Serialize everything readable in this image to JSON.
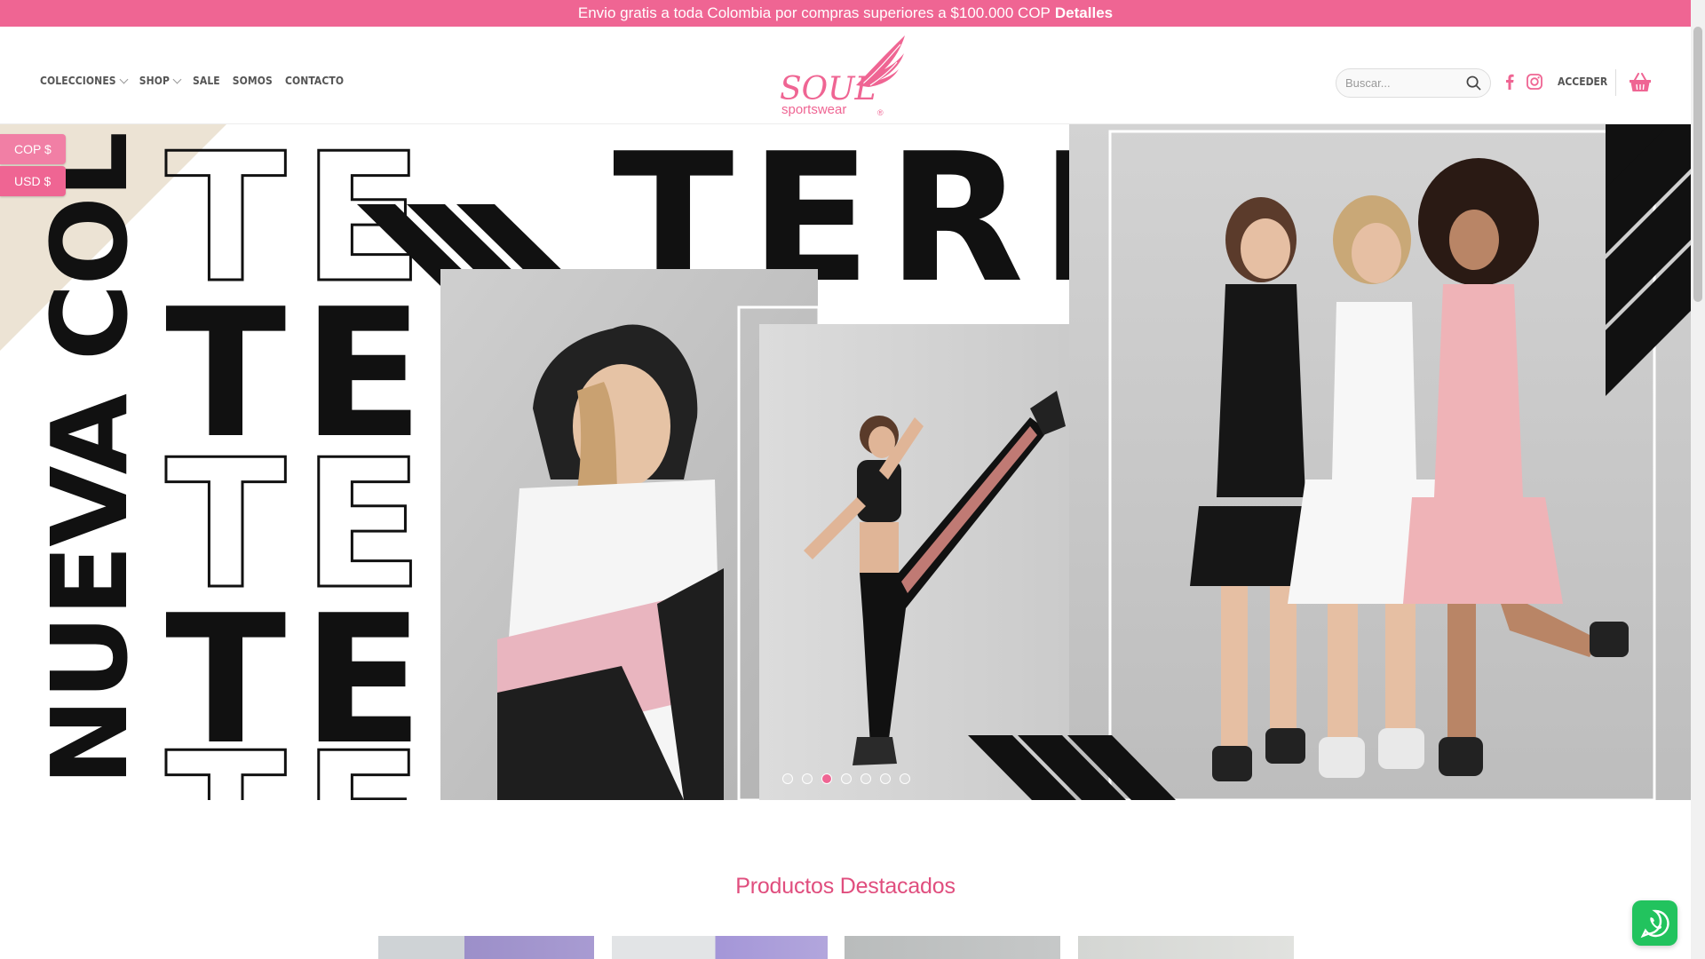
{
  "topbar": {
    "message": "Envio gratis a toda Colombia por compras superiores a $100.000 COP",
    "link": "Detalles"
  },
  "nav": {
    "items": [
      {
        "label": "COLECCIONES",
        "dropdown": true
      },
      {
        "label": "SHOP",
        "dropdown": true
      },
      {
        "label": "SALE",
        "dropdown": false
      },
      {
        "label": "SOMOS",
        "dropdown": false
      },
      {
        "label": "CONTACTO",
        "dropdown": false
      }
    ]
  },
  "logo": {
    "wordmark": "SOUL",
    "tagline": "sportswear",
    "mark": "®"
  },
  "search": {
    "placeholder": "Buscar..."
  },
  "header": {
    "login_label": "ACCEDER"
  },
  "currency": {
    "options": [
      "COP $",
      "USD $"
    ]
  },
  "hero": {
    "vertical_text": "NUEVA COLECCIÓN",
    "headline": "TERRA",
    "slides": 7,
    "active_slide": 3
  },
  "featured": {
    "title": "Productos Destacados"
  },
  "colors": {
    "brand_pink": "#ef6593",
    "title_pink": "#e04e7e",
    "whatsapp": "#22c35e"
  },
  "icons": [
    "search-icon",
    "facebook-icon",
    "instagram-icon",
    "cart-basket-icon",
    "whatsapp-icon"
  ]
}
